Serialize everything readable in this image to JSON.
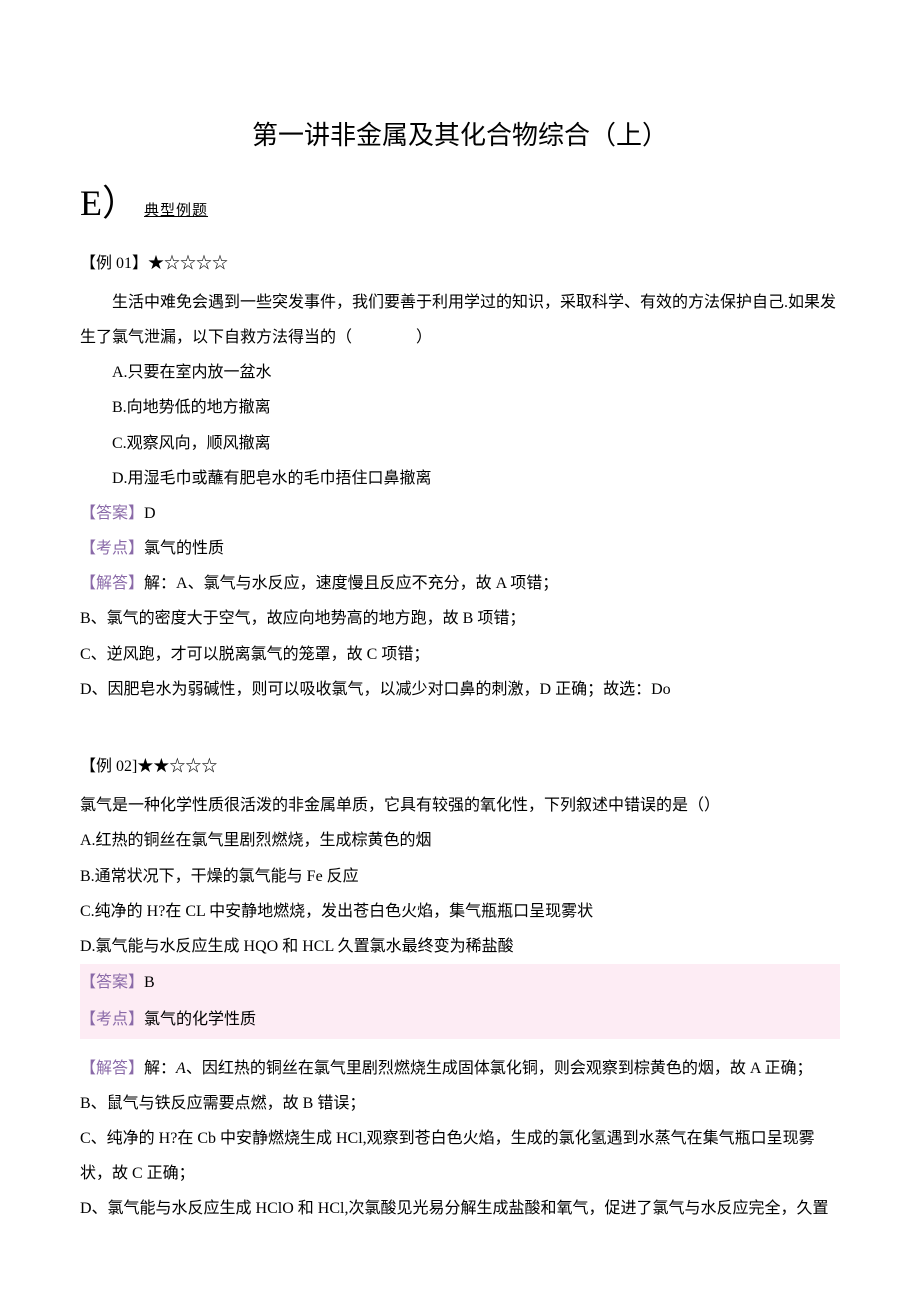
{
  "title": "第一讲非金属及其化合物综合（上）",
  "section": {
    "marker": "E）",
    "label": "典型例题"
  },
  "ex1": {
    "header_label": "【例 01】",
    "stars": "★☆☆☆☆",
    "stem1": "生活中难免会遇到一些突发事件，我们要善于利用学过的知识，采取科学、有效的方法保护自己.如果发",
    "stem2": "生了氯气泄漏，以下自救方法得当的（　　　　）",
    "optA": "A.只要在室内放一盆水",
    "optB": "B.向地势低的地方撤离",
    "optC": "C.观察风向，顺风撤离",
    "optD": "D.用湿毛巾或蘸有肥皂水的毛巾捂住口鼻撤离",
    "ans_tag": "【答案】",
    "ans": "D",
    "point_tag": "【考点】",
    "point": "氯气的性质",
    "solve_tag": "【解答】",
    "solveA": "解：A、氯气与水反应，速度慢且反应不充分，故 A 项错；",
    "solveB": "B、氯气的密度大于空气，故应向地势高的地方跑，故 B 项错；",
    "solveC": "C、逆风跑，才可以脱离氯气的笼罩，故 C 项错；",
    "solveD": "D、因肥皂水为弱碱性，则可以吸收氯气，以减少对口鼻的刺激，D 正确；故选：Do"
  },
  "ex2": {
    "header_label": "【例 02]",
    "stars": "★★☆☆☆",
    "stem": "氯气是一种化学性质很活泼的非金属单质，它具有较强的氧化性，下列叙述中错误的是（）",
    "optA": "A.红热的铜丝在氯气里剧烈燃烧，生成棕黄色的烟",
    "optB": "B.通常状况下，干燥的氯气能与 Fe 反应",
    "optC": "C.纯净的 H?在 CL 中安静地燃烧，发出苍白色火焰，集气瓶瓶口呈现雾状",
    "optD": "D.氯气能与水反应生成 HQO 和 HCL 久置氯水最终变为稀盐酸",
    "ans_tag": "【答案】",
    "ans": "B",
    "point_tag": "【考点】",
    "point": "氯气的化学性质",
    "solve_tag": "【解答】",
    "solveA_pre": "解：",
    "solveA_it": "A",
    "solveA_post": "、因红热的铜丝在氯气里剧烈燃烧生成固体氯化铜，则会观察到棕黄色的烟，故 A 正确；",
    "solveB": "B、鼠气与铁反应需要点燃，故 B 错误；",
    "solveC1": "C、纯净的 H?在 Cb 中安静燃烧生成 HCl,观察到苍白色火焰，生成的氯化氢遇到水蒸气在集气瓶口呈现雾",
    "solveC2": "状，故 C 正确；",
    "solveD": "D、氯气能与水反应生成 HClO 和 HCl,次氯酸见光易分解生成盐酸和氧气，促进了氯气与水反应完全，久置"
  }
}
